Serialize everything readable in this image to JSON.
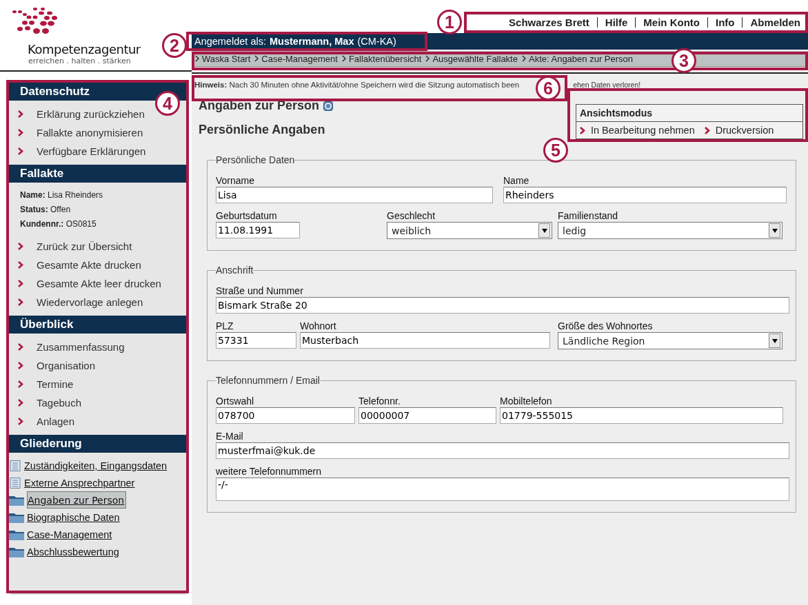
{
  "logo": {
    "name": "Kompetenzagentur",
    "tagline": "erreichen . halten . stärken"
  },
  "top_nav": [
    "Schwarzes Brett",
    "Hilfe",
    "Mein Konto",
    "Info",
    "Abmelden"
  ],
  "login": {
    "prefix": "Angemeldet als:",
    "user": "Mustermann, Max",
    "role": "(CM-KA)"
  },
  "breadcrumb": [
    "Waska Start",
    "Case-Management",
    "Fallaktenübersicht",
    "Ausgewählte Fallakte",
    "Akte: Angaben zur Person"
  ],
  "sidebar": [
    {
      "title": "Datenschutz",
      "items": [
        "Erklärung zurückziehen",
        "Fallakte anonymisieren",
        "Verfügbare Erklärungen"
      ]
    },
    {
      "title": "Fallakte",
      "info": [
        {
          "label": "Name:",
          "value": "Lisa Rheinders"
        },
        {
          "label": "Status:",
          "value": "Offen"
        },
        {
          "label": "Kundennr.:",
          "value": "OS0815"
        }
      ],
      "items": [
        "Zurück zur Übersicht",
        "Gesamte Akte drucken",
        "Gesamte Akte leer drucken",
        "Wiedervorlage anlegen"
      ]
    },
    {
      "title": "Überblick",
      "items": [
        "Zusammenfassung",
        "Organisation",
        "Termine",
        "Tagebuch",
        "Anlagen"
      ]
    },
    {
      "title": "Gliederung",
      "outline": [
        {
          "label": "Zuständigkeiten, Eingangsdaten",
          "kind": "document",
          "selected": false
        },
        {
          "label": "Externe Ansprechpartner",
          "kind": "document",
          "selected": false
        },
        {
          "label": "Angaben zur Person",
          "kind": "folder",
          "selected": true
        },
        {
          "label": "Biographische Daten",
          "kind": "folder",
          "selected": false
        },
        {
          "label": "Case-Management",
          "kind": "folder",
          "selected": false
        },
        {
          "label": "Abschlussbewertung",
          "kind": "folder",
          "selected": false
        }
      ]
    }
  ],
  "hint": {
    "label": "Hinweis:",
    "text": "Nach 30 Minuten ohne Aktivität/ohne Speichern wird die Sitzung automatisch been",
    "tail": "ehen Daten verloren!"
  },
  "page_title": "Angaben zur Person",
  "section_title": "Persönliche Angaben",
  "view_mode": {
    "title": "Ansichtsmodus",
    "links": [
      "In Bearbeitung nehmen",
      "Druckversion"
    ]
  },
  "fieldsets": [
    {
      "legend": "Persönliche Daten",
      "rows": [
        [
          {
            "label": "Vorname",
            "value": "Lisa",
            "kind": "text"
          },
          {
            "label": "Name",
            "value": "Rheinders",
            "kind": "text"
          }
        ],
        [
          {
            "label": "Geburtsdatum",
            "value": "11.08.1991",
            "kind": "text"
          },
          {
            "label": "Geschlecht",
            "value": "weiblich",
            "kind": "select"
          },
          {
            "label": "Familienstand",
            "value": "ledig",
            "kind": "select"
          }
        ]
      ]
    },
    {
      "legend": "Anschrift",
      "rows": [
        [
          {
            "label": "Straße und Nummer",
            "value": "Bismark Straße 20",
            "kind": "text"
          }
        ],
        [
          {
            "label": "PLZ",
            "value": "57331",
            "kind": "text"
          },
          {
            "label": "Wohnort",
            "value": "Musterbach",
            "kind": "text"
          },
          {
            "label": "Größe des Wohnortes",
            "value": "Ländliche Region",
            "kind": "select"
          }
        ]
      ]
    },
    {
      "legend": "Telefonnummern / Email",
      "rows": [
        [
          {
            "label": "Ortswahl",
            "value": "078700",
            "kind": "text"
          },
          {
            "label": "Telefonnr.",
            "value": "00000007",
            "kind": "text"
          },
          {
            "label": "Mobiltelefon",
            "value": "01779-555015",
            "kind": "text"
          }
        ],
        [
          {
            "label": "E-Mail",
            "value": "musterfmai@kuk.de",
            "kind": "text"
          }
        ],
        [
          {
            "label": "weitere Telefonnummern",
            "value": "-/-",
            "kind": "textarea"
          }
        ]
      ]
    }
  ],
  "annotations": [
    "1",
    "2",
    "3",
    "4",
    "5",
    "6"
  ]
}
